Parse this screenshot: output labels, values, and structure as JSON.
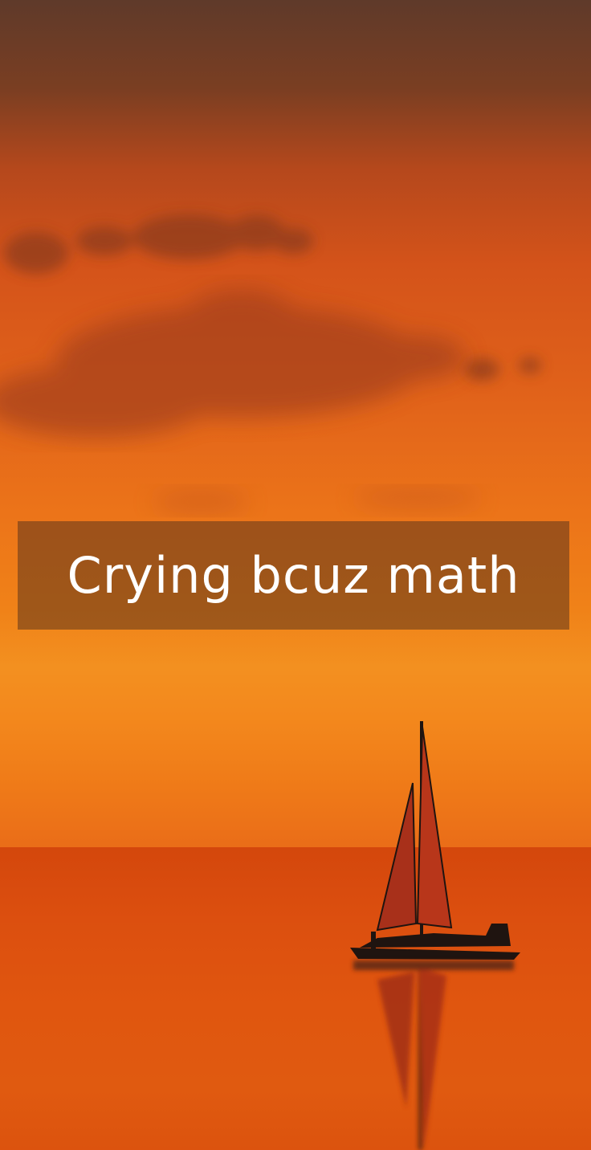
{
  "caption": {
    "text": "Crying bcuz math"
  },
  "scene": {
    "sky_top_color": "#5f3a2a",
    "sky_mid_color": "#e0611a",
    "horizon_color": "#f39020",
    "sea_color": "#d4470c",
    "silhouette_color": "#1f1410",
    "sail_color": "#a8301a"
  }
}
